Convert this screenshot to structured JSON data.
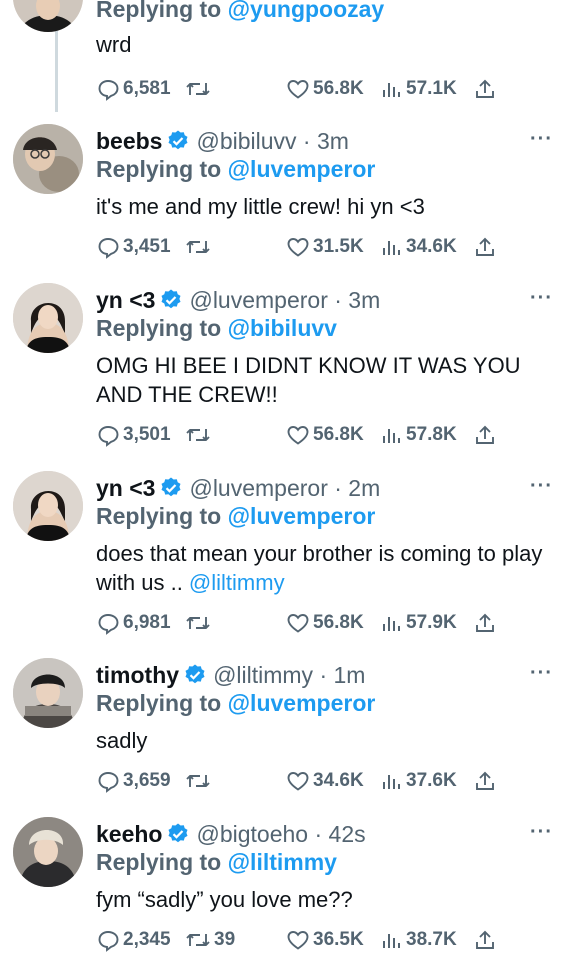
{
  "top_tweet": {
    "reply_prefix": "Replying to ",
    "reply_to": "@yungpoozay",
    "body": "wrd",
    "replies": "6,581",
    "retweets": "",
    "likes": "56.8K",
    "views": "57.1K"
  },
  "tweets": [
    {
      "name": "beebs",
      "handle": "@bibiluvv · 3m",
      "reply_prefix": "Replying to ",
      "reply_to": "@luvemperor",
      "body": "it's me and my little crew! hi yn <3",
      "body_link": "",
      "replies": "3,451",
      "retweets": "",
      "likes": "31.5K",
      "views": "34.6K",
      "more": "···"
    },
    {
      "name": "yn <3",
      "handle": "@luvemperor · 3m",
      "reply_prefix": "Replying to ",
      "reply_to": "@bibiluvv",
      "body": "OMG HI BEE I DIDNT KNOW IT WAS YOU AND THE CREW!!",
      "body_link": "",
      "replies": "3,501",
      "retweets": "",
      "likes": "56.8K",
      "views": "57.8K",
      "more": "···"
    },
    {
      "name": "yn <3",
      "handle": "@luvemperor · 2m",
      "reply_prefix": "Replying to ",
      "reply_to": "@luvemperor",
      "body": "does that mean your brother is coming to play with us .. ",
      "body_link": "@liltimmy",
      "replies": "6,981",
      "retweets": "",
      "likes": "56.8K",
      "views": "57.9K",
      "more": "···"
    },
    {
      "name": "timothy",
      "handle": "@liltimmy · 1m",
      "reply_prefix": "Replying to ",
      "reply_to": "@luvemperor",
      "body": "sadly",
      "body_link": "",
      "replies": "3,659",
      "retweets": "",
      "likes": "34.6K",
      "views": "37.6K",
      "more": "···"
    },
    {
      "name": "keeho",
      "handle": "@bigtoeho · 42s",
      "reply_prefix": "Replying to ",
      "reply_to": "@liltimmy",
      "body": "fym “sadly” you love me??",
      "body_link": "",
      "replies": "2,345",
      "retweets": "39",
      "likes": "36.5K",
      "views": "38.7K",
      "more": "···"
    }
  ],
  "colors": {
    "accent": "#1d9bf0",
    "text": "#0f1419",
    "muted": "#536471",
    "verified": "#1d9bf0"
  },
  "icons": [
    "reply-icon",
    "retweet-icon",
    "like-icon",
    "views-icon",
    "share-icon",
    "verified-badge-icon",
    "more-icon"
  ]
}
